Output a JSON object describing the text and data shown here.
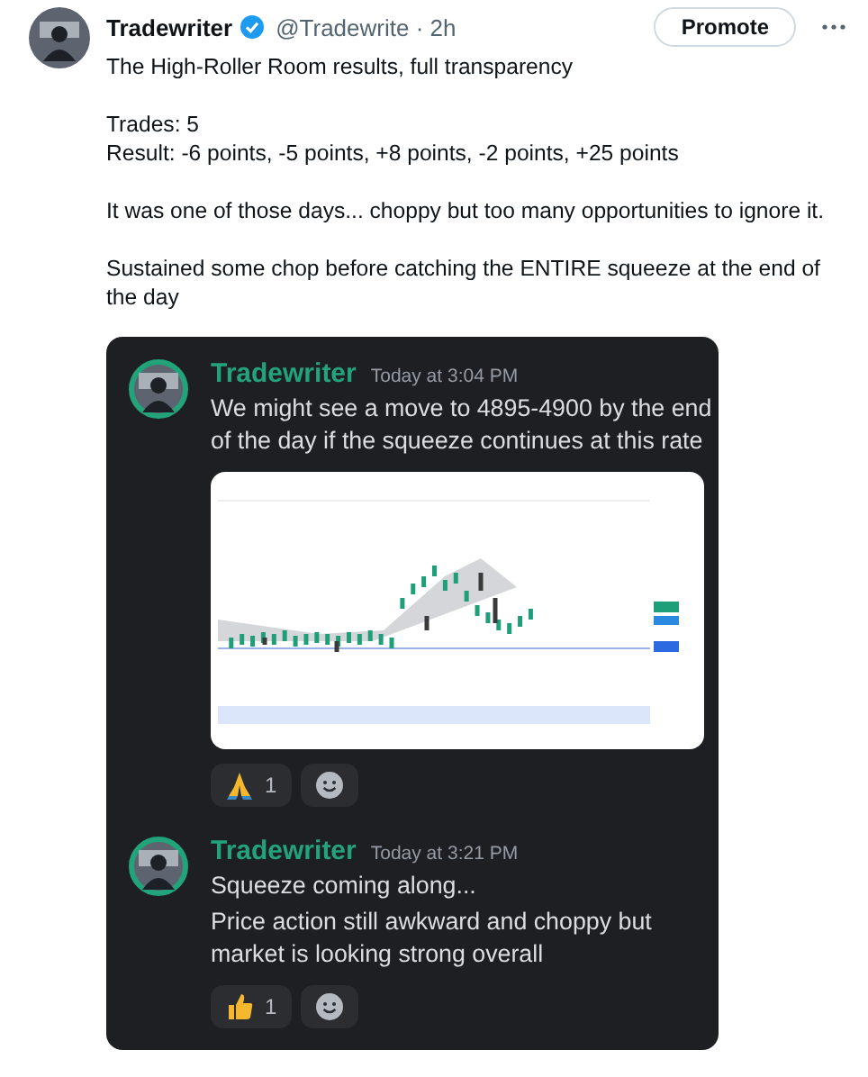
{
  "post": {
    "author": "Tradewriter",
    "verified": true,
    "meta": "@Tradewrite · 2h",
    "promote": "Promote",
    "paragraphs": [
      [
        "The High-Roller Room results, full transparency"
      ],
      [
        "Trades: 5",
        "Result: -6 points, -5 points, +8 points, -2 points, +25 points"
      ],
      [
        "It was one of those days... choppy but too many opportunities to ignore it."
      ],
      [
        "Sustained some chop before catching the ENTIRE squeeze at the end of the day"
      ]
    ]
  },
  "messages": [
    {
      "author": "Tradewriter",
      "time": "Today at 3:04 PM",
      "lines": [
        "We might see a move to 4895-4900 by the end of the day if the squeeze continues at this rate"
      ],
      "attachment": {
        "kind": "picture"
      },
      "reactions": [
        {
          "kind": "pray",
          "count": "1"
        }
      ]
    },
    {
      "author": "Tradewriter",
      "time": "Today at 3:21 PM",
      "lines": [
        "Squeeze coming along...",
        "Price action still awkward and choppy but market is looking strong overall"
      ],
      "reactions": [
        {
          "kind": "thumbs_up",
          "count": "1"
        }
      ]
    }
  ]
}
